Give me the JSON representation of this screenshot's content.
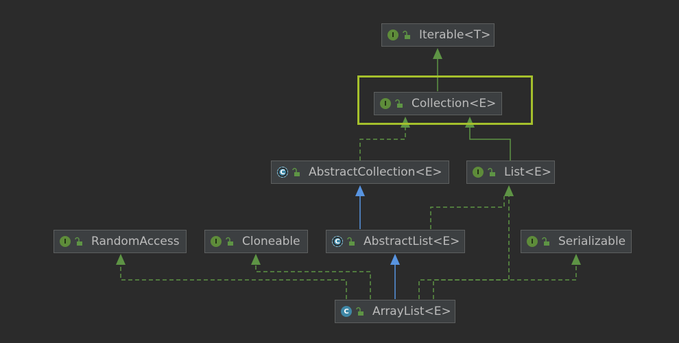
{
  "nodes": {
    "iterable": {
      "label": "Iterable<T>",
      "kind": "interface",
      "badge": "I"
    },
    "collection": {
      "label": "Collection<E>",
      "kind": "interface",
      "badge": "I"
    },
    "abstract_collection": {
      "label": "AbstractCollection<E>",
      "kind": "abstract",
      "badge": "C"
    },
    "list": {
      "label": "List<E>",
      "kind": "interface",
      "badge": "I"
    },
    "random_access": {
      "label": "RandomAccess",
      "kind": "interface",
      "badge": "I"
    },
    "cloneable": {
      "label": "Cloneable",
      "kind": "interface",
      "badge": "I"
    },
    "abstract_list": {
      "label": "AbstractList<E>",
      "kind": "abstract",
      "badge": "C"
    },
    "serializable": {
      "label": "Serializable",
      "kind": "interface",
      "badge": "I"
    },
    "array_list": {
      "label": "ArrayList<E>",
      "kind": "class",
      "badge": "C"
    }
  },
  "edges": [
    {
      "from": "collection",
      "to": "iterable",
      "relation": "extends"
    },
    {
      "from": "abstract_collection",
      "to": "collection",
      "relation": "implements"
    },
    {
      "from": "list",
      "to": "collection",
      "relation": "extends"
    },
    {
      "from": "abstract_list",
      "to": "abstract_collection",
      "relation": "extends"
    },
    {
      "from": "abstract_list",
      "to": "list",
      "relation": "implements"
    },
    {
      "from": "array_list",
      "to": "abstract_list",
      "relation": "extends"
    },
    {
      "from": "array_list",
      "to": "list",
      "relation": "implements"
    },
    {
      "from": "array_list",
      "to": "random_access",
      "relation": "implements"
    },
    {
      "from": "array_list",
      "to": "cloneable",
      "relation": "implements"
    },
    {
      "from": "array_list",
      "to": "serializable",
      "relation": "implements"
    }
  ],
  "highlighted_node": "collection",
  "icons": {
    "interface": "interface-icon",
    "abstract": "abstract-class-icon",
    "class": "class-icon",
    "access": "unlocked-icon"
  },
  "colors": {
    "background": "#2b2b2b",
    "node_fill": "#3c3f41",
    "node_border": "#5e6060",
    "text": "#bbbbbb",
    "interface_edge": "#5e9445",
    "class_edge": "#5894e0",
    "highlight": "#a5c02c"
  }
}
